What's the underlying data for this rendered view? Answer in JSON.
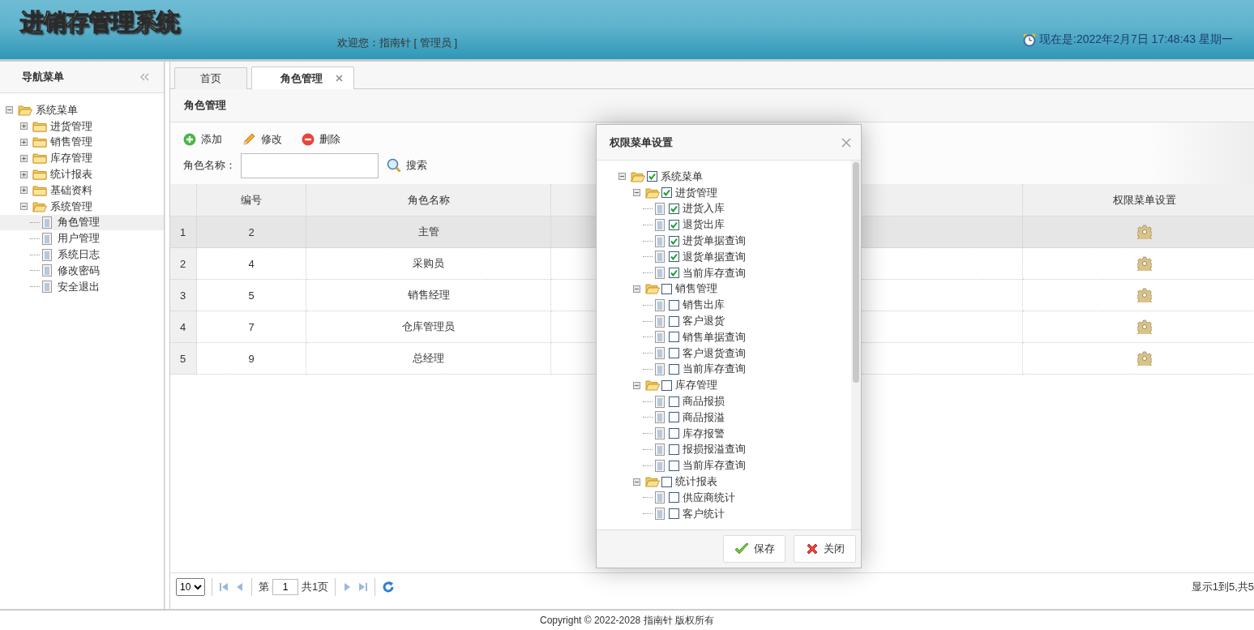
{
  "header": {
    "title": "进销存管理系统",
    "welcome": "欢迎您：指南针 [ 管理员 ]",
    "clock": "现在是:2022年2月7日 17:48:43 星期一"
  },
  "sidebar": {
    "title": "导航菜单",
    "tree": [
      {
        "label": "系统菜单",
        "expanded": true,
        "selected": false,
        "children": [
          {
            "label": "进货管理",
            "expanded": false,
            "selected": false
          },
          {
            "label": "销售管理",
            "expanded": false,
            "selected": false
          },
          {
            "label": "库存管理",
            "expanded": false,
            "selected": false
          },
          {
            "label": "统计报表",
            "expanded": false,
            "selected": false
          },
          {
            "label": "基础资料",
            "expanded": false,
            "selected": false
          },
          {
            "label": "系统管理",
            "expanded": true,
            "selected": false,
            "children": [
              {
                "label": "角色管理",
                "selected": true
              },
              {
                "label": "用户管理",
                "selected": false
              },
              {
                "label": "系统日志",
                "selected": false
              },
              {
                "label": "修改密码",
                "selected": false
              },
              {
                "label": "安全退出",
                "selected": false
              }
            ]
          }
        ]
      }
    ]
  },
  "tabs": [
    {
      "label": "首页",
      "selected": false,
      "closable": false
    },
    {
      "label": "角色管理",
      "selected": true,
      "closable": true
    }
  ],
  "panel": {
    "title": "角色管理",
    "toolbar": [
      {
        "label": "添加",
        "kind": "add"
      },
      {
        "label": "修改",
        "kind": "edit"
      },
      {
        "label": "删除",
        "kind": "delete"
      }
    ],
    "search": {
      "label": "角色名称：",
      "button": "搜索"
    }
  },
  "table": {
    "columns": [
      {
        "label": "编号"
      },
      {
        "label": "角色名称"
      },
      {
        "label": "权限菜单设置"
      }
    ],
    "rows": [
      {
        "index": "1",
        "cells": [
          "2",
          "主管"
        ],
        "selected": true
      },
      {
        "index": "2",
        "cells": [
          "4",
          "采购员"
        ],
        "selected": false
      },
      {
        "index": "3",
        "cells": [
          "5",
          "销售经理"
        ],
        "selected": false
      },
      {
        "index": "4",
        "cells": [
          "7",
          "仓库管理员"
        ],
        "selected": false
      },
      {
        "index": "5",
        "cells": [
          "9",
          "总经理"
        ],
        "selected": false
      }
    ]
  },
  "pager": {
    "page_size": "10",
    "page_prefix": "第",
    "page": "1",
    "page_total": "共1页",
    "summary": "显示1到5,共5"
  },
  "dialog": {
    "title": "权限菜单设置",
    "tree": [
      {
        "label": "系统菜单",
        "expanded": true,
        "checked": true,
        "children": [
          {
            "label": "进货管理",
            "expanded": true,
            "checked": true,
            "children": [
              {
                "label": "进货入库",
                "checked": true
              },
              {
                "label": "退货出库",
                "checked": true
              },
              {
                "label": "进货单据查询",
                "checked": true
              },
              {
                "label": "退货单据查询",
                "checked": true
              },
              {
                "label": "当前库存查询",
                "checked": true
              }
            ]
          },
          {
            "label": "销售管理",
            "expanded": true,
            "checked": false,
            "children": [
              {
                "label": "销售出库",
                "checked": false
              },
              {
                "label": "客户退货",
                "checked": false
              },
              {
                "label": "销售单据查询",
                "checked": false
              },
              {
                "label": "客户退货查询",
                "checked": false
              },
              {
                "label": "当前库存查询",
                "checked": false
              }
            ]
          },
          {
            "label": "库存管理",
            "expanded": true,
            "checked": false,
            "children": [
              {
                "label": "商品报损",
                "checked": false
              },
              {
                "label": "商品报溢",
                "checked": false
              },
              {
                "label": "库存报警",
                "checked": false
              },
              {
                "label": "报损报溢查询",
                "checked": false
              },
              {
                "label": "当前库存查询",
                "checked": false
              }
            ]
          },
          {
            "label": "统计报表",
            "expanded": true,
            "checked": false,
            "children": [
              {
                "label": "供应商统计",
                "checked": false
              },
              {
                "label": "客户统计",
                "checked": false
              }
            ]
          }
        ]
      }
    ],
    "buttons": [
      {
        "label": "保存",
        "kind": "save"
      },
      {
        "label": "关闭",
        "kind": "close"
      }
    ]
  },
  "footer": "Copyright © 2022-2028 指南针 版权所有"
}
